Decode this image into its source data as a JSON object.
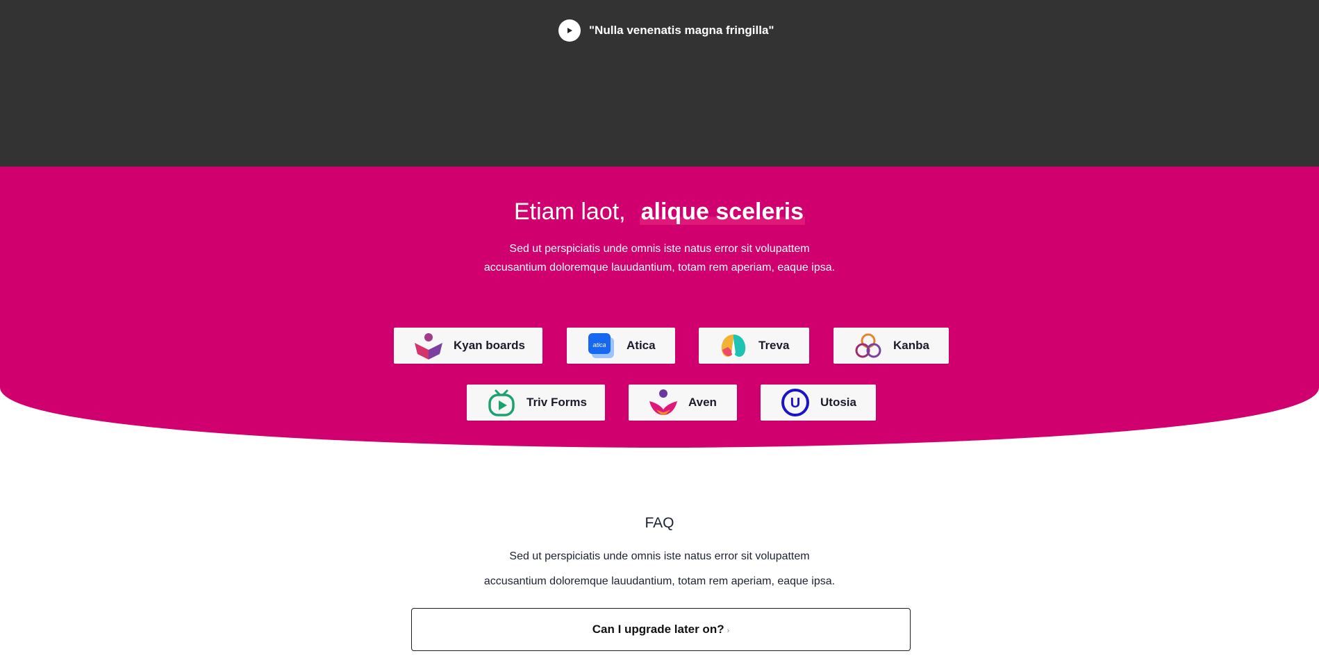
{
  "video": {
    "title": "\"Nulla venenatis magna fringilla\"",
    "play_icon": "play-icon"
  },
  "brands": {
    "heading_light": "Etiam laot,",
    "heading_strong": "alique sceleris",
    "subtitle_line1": "Sed ut perspiciatis unde omnis iste natus error sit volupattem",
    "subtitle_line2": "accusantium doloremque lauudantium, totam rem aperiam, eaque ipsa.",
    "items": [
      {
        "label": "Kyan boards",
        "icon": "kyan-boards-logo-icon"
      },
      {
        "label": "Atica",
        "icon": "atica-logo-icon",
        "icon_text": "atica"
      },
      {
        "label": "Treva",
        "icon": "treva-logo-icon"
      },
      {
        "label": "Kanba",
        "icon": "kanba-logo-icon"
      },
      {
        "label": "Triv Forms",
        "icon": "triv-forms-logo-icon"
      },
      {
        "label": "Aven",
        "icon": "aven-logo-icon"
      },
      {
        "label": "Utosia",
        "icon": "utosia-logo-icon",
        "icon_text": "U"
      }
    ]
  },
  "faq": {
    "title": "FAQ",
    "subtitle_line1": "Sed ut perspiciatis unde omnis iste natus error sit volupattem",
    "subtitle_line2": "accusantium doloremque lauudantium, totam rem aperiam, eaque ipsa.",
    "items": [
      {
        "question": "Can I upgrade later on?",
        "chevron": "›"
      }
    ]
  },
  "colors": {
    "dark_bg": "#333333",
    "brand_magenta": "#d1006f",
    "card_bg": "#f7f7f8"
  }
}
